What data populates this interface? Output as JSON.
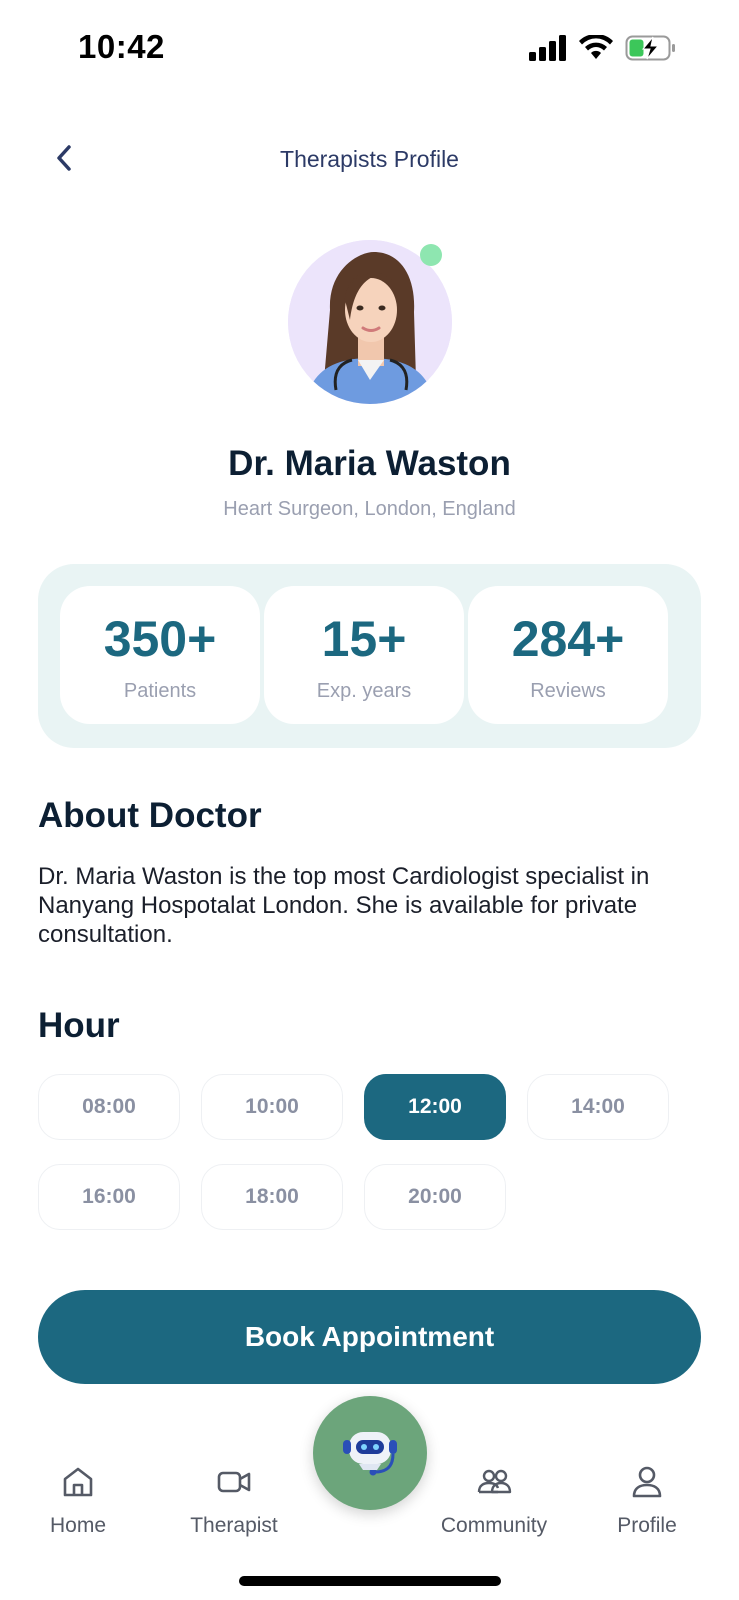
{
  "status_bar": {
    "time": "10:42"
  },
  "header": {
    "title": "Therapists Profile"
  },
  "doctor": {
    "name": "Dr. Maria Waston",
    "specialty": "Heart Surgeon, London, England"
  },
  "stats": [
    {
      "value": "350+",
      "label": "Patients"
    },
    {
      "value": "15+",
      "label": "Exp. years"
    },
    {
      "value": "284+",
      "label": "Reviews"
    }
  ],
  "about": {
    "title": "About Doctor",
    "text": "Dr. Maria Waston is the top most Cardiologist specialist in Nanyang Hospotalat London. She is available for private consultation."
  },
  "hours": {
    "title": "Hour",
    "slots": [
      "08:00",
      "10:00",
      "12:00",
      "14:00",
      "16:00",
      "18:00",
      "20:00"
    ],
    "selected": "12:00"
  },
  "book_button": {
    "label": "Book Appointment"
  },
  "nav": {
    "items": [
      {
        "label": "Home",
        "icon": "home-icon"
      },
      {
        "label": "Therapist",
        "icon": "video-icon"
      },
      {
        "label": "Community",
        "icon": "community-icon"
      },
      {
        "label": "Profile",
        "icon": "person-icon"
      }
    ],
    "fab_icon": "robot-assistant-icon"
  },
  "colors": {
    "primary": "#1c6880",
    "stats_panel": "#e9f4f4",
    "fab": "#6ca57b",
    "online": "#8ee6b0"
  }
}
